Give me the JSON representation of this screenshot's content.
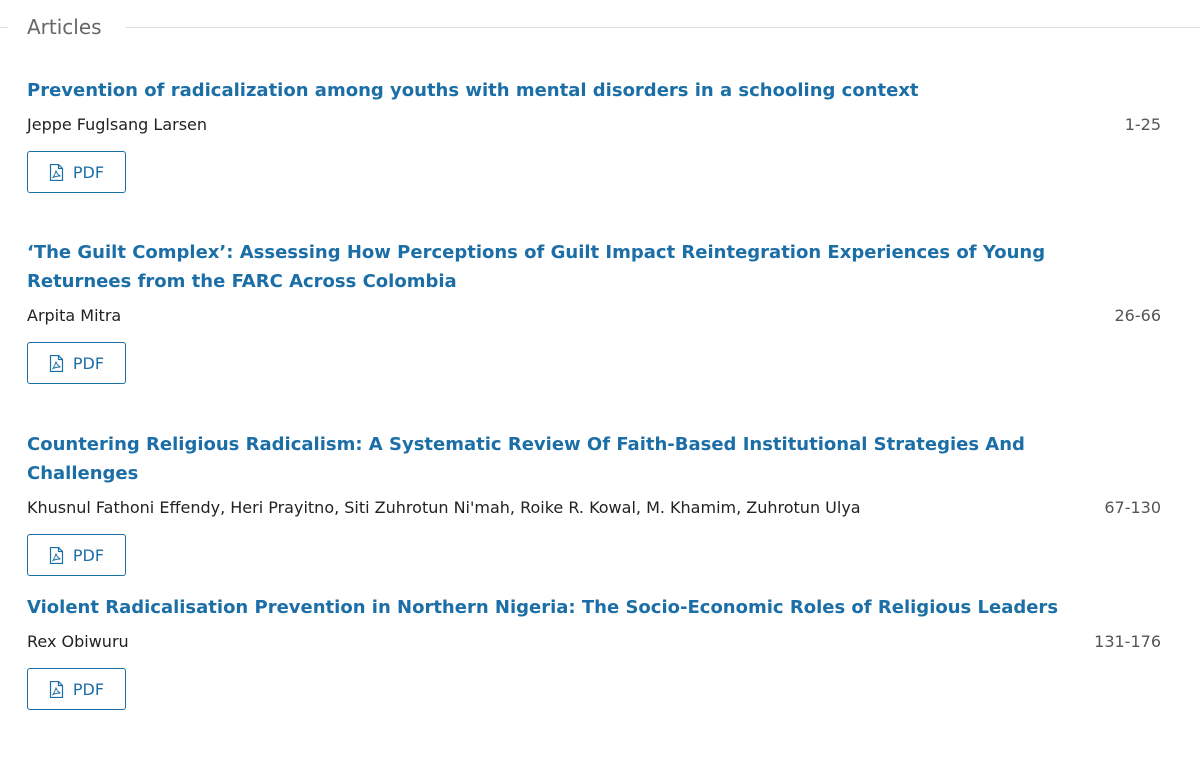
{
  "section": {
    "title": "Articles"
  },
  "articles": [
    {
      "title": "Prevention of radicalization among youths with mental disorders in a schooling context",
      "authors": "Jeppe Fuglsang Larsen",
      "pages": "1-25",
      "galley_label": "PDF",
      "icon": "pdf-file-icon"
    },
    {
      "title": "‘The Guilt Complex’: Assessing How Perceptions of Guilt Impact Reintegration Experiences of Young Returnees from the FARC Across Colombia",
      "authors": "Arpita Mitra",
      "pages": "26-66",
      "galley_label": "PDF",
      "icon": "pdf-file-icon"
    },
    {
      "title": "Countering Religious Radicalism: A Systematic Review Of Faith-Based Institutional Strategies And Challenges",
      "authors": "Khusnul Fathoni Effendy, Heri Prayitno, Siti Zuhrotun Ni'mah, Roike R. Kowal, M. Khamim, Zuhrotun Ulya",
      "pages": "67-130",
      "galley_label": "PDF",
      "icon": "pdf-file-icon"
    },
    {
      "title": "Violent Radicalisation Prevention in Northern Nigeria: The Socio-Economic Roles of Religious Leaders",
      "authors": "Rex Obiwuru",
      "pages": "131-176",
      "galley_label": "PDF",
      "icon": "pdf-file-icon"
    }
  ],
  "colors": {
    "link": "#1c6ea6",
    "heading": "#666666",
    "text": "#222222",
    "rule": "#dddddd"
  }
}
